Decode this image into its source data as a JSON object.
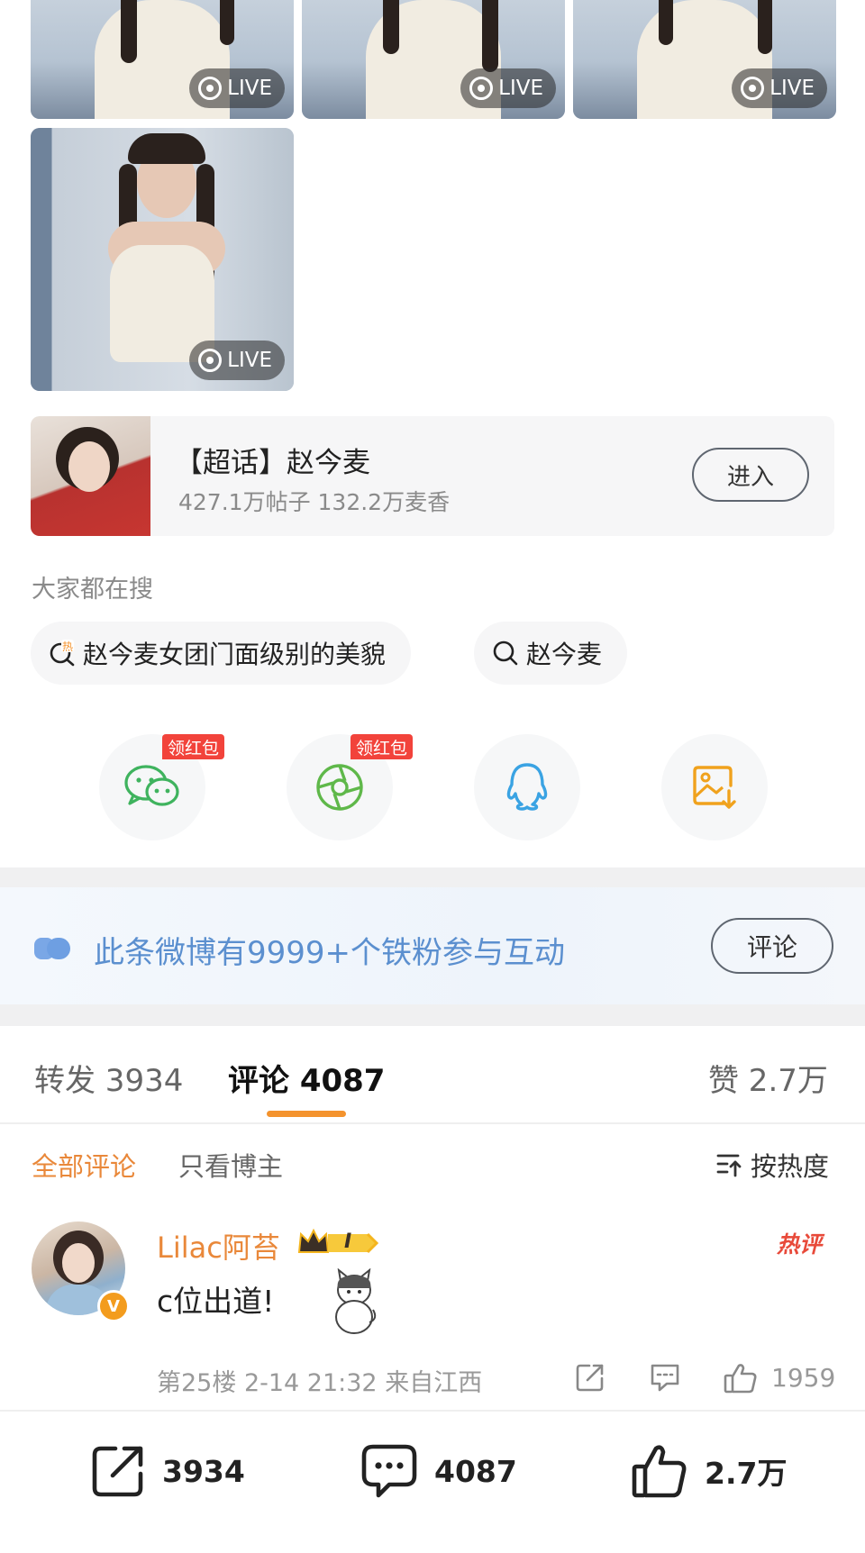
{
  "photos": [
    {
      "badge": "LIVE"
    },
    {
      "badge": "LIVE"
    },
    {
      "badge": "LIVE"
    },
    {
      "badge": "LIVE"
    }
  ],
  "super_topic": {
    "title": "【超话】赵今麦",
    "subtitle": "427.1万帖子 132.2万麦香",
    "enter_label": "进入"
  },
  "search": {
    "section_label": "大家都在搜",
    "chips": [
      {
        "text": "赵今麦女团门面级别的美貌",
        "icon": "hot-search-icon"
      },
      {
        "text": "赵今麦",
        "icon": "search-icon"
      }
    ]
  },
  "share": {
    "items": [
      {
        "icon": "wechat-icon",
        "tag": "领红包"
      },
      {
        "icon": "moments-icon",
        "tag": "领红包"
      },
      {
        "icon": "qq-icon",
        "tag": ""
      },
      {
        "icon": "save-image-icon",
        "tag": ""
      }
    ]
  },
  "fans_banner": {
    "text": "此条微博有9999+个铁粉参与互动",
    "button": "评论"
  },
  "stats_tabs": {
    "repost": "转发 3934",
    "comment": "评论 4087",
    "like": "赞 2.7万"
  },
  "comment_filter": {
    "all": "全部评论",
    "author_only": "只看博主",
    "sort": "按热度"
  },
  "comments": [
    {
      "user": "Lilac阿苔",
      "level": "I",
      "verified_badge": "V",
      "tag": "热评",
      "text": "c位出道!",
      "meta": "第25楼 2-14 21:32 来自江西",
      "likes": "1959"
    }
  ],
  "bottom_bar": {
    "repost_count": "3934",
    "comment_count": "4087",
    "like_count": "2.7万"
  },
  "colors": {
    "accent_orange": "#e9883a",
    "link_blue": "#5b8fcf",
    "red_tag": "#f2433b",
    "wechat_green": "#3fb35e",
    "qq_blue": "#3aa3e3",
    "save_orange": "#f0a21d"
  }
}
